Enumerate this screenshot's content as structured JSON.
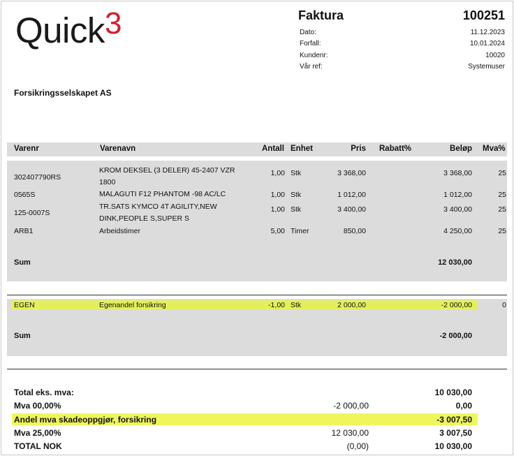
{
  "logo": {
    "word": "Quick",
    "number": "3"
  },
  "invoice": {
    "title": "Faktura",
    "number": "100251",
    "meta": [
      {
        "label": "Dato:",
        "value": "11.12.2023"
      },
      {
        "label": "Forfall:",
        "value": "10.01.2024"
      },
      {
        "label": "Kundenr:",
        "value": "10020"
      },
      {
        "label": "Vår ref:",
        "value": "Systemuser"
      }
    ]
  },
  "customer": {
    "name": "Forsikringsselskapet AS"
  },
  "table": {
    "headers": {
      "varenr": "Varenr",
      "varenavn": "Varenavn",
      "antall": "Antall",
      "enhet": "Enhet",
      "pris": "Pris",
      "rabatt": "Rabatt%",
      "belop": "Beløp",
      "mva": "Mva%"
    },
    "rows": [
      {
        "varenr": "302407790RS",
        "varenavn": "KROM DEKSEL (3 DELER) 45-2407 VZR 1800",
        "antall": "1,00",
        "enhet": "Stk",
        "pris": "3 368,00",
        "belop": "3 368,00",
        "mva": "25"
      },
      {
        "varenr": "0565S",
        "varenavn": "MALAGUTI F12 PHANTOM -98 AC/LC",
        "antall": "1,00",
        "enhet": "Stk",
        "pris": "1 012,00",
        "belop": "1 012,00",
        "mva": "25"
      },
      {
        "varenr": "125-0007S",
        "varenavn": "TR.SATS KYMCO 4T AGILITY,NEW DINK,PEOPLE S,SUPER S",
        "antall": "1,00",
        "enhet": "Stk",
        "pris": "3 400,00",
        "belop": "3 400,00",
        "mva": "25"
      },
      {
        "varenr": "ARB1",
        "varenavn": "Arbeidstimer",
        "antall": "5,00",
        "enhet": "Timer",
        "pris": "850,00",
        "belop": "4 250,00",
        "mva": "25"
      }
    ],
    "sum1": {
      "label": "Sum",
      "value": "12 030,00"
    },
    "egen_row": {
      "varenr": "EGEN",
      "varenavn": "Egenandel forsikring",
      "antall": "-1,00",
      "enhet": "Stk",
      "pris": "2 000,00",
      "belop": "-2 000,00",
      "mva": "0"
    },
    "sum2": {
      "label": "Sum",
      "value": "-2 000,00"
    }
  },
  "totals": {
    "total_eks": {
      "label": "Total eks. mva:",
      "value": "10 030,00"
    },
    "mva00": {
      "label": "Mva 00,00%",
      "base": "-2 000,00",
      "value": "0,00"
    },
    "andel": {
      "label": "Andel mva skadeoppgjør, forsikring",
      "value": "-3 007,50"
    },
    "mva25": {
      "label": "Mva 25,00%",
      "base": "12 030,00",
      "value": "3 007,50"
    },
    "total_nok": {
      "label": "TOTAL NOK",
      "base": "(0,00)",
      "value": "10 030,00"
    }
  },
  "colors": {
    "logo_red": "#d0202e",
    "band_gray": "#dcdcdc",
    "highlight": "#e4f05a"
  }
}
